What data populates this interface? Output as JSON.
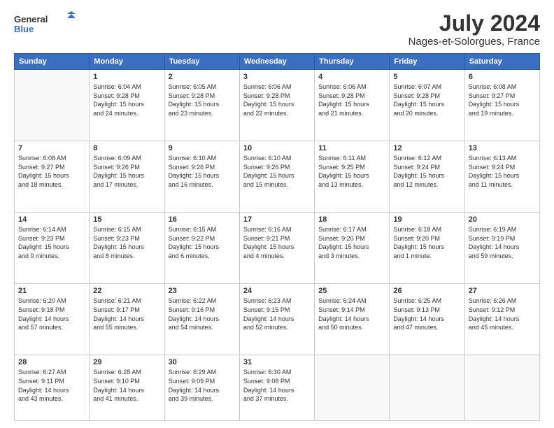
{
  "logo": {
    "line1": "General",
    "line2": "Blue"
  },
  "title": "July 2024",
  "subtitle": "Nages-et-Solorgues, France",
  "days_of_week": [
    "Sunday",
    "Monday",
    "Tuesday",
    "Wednesday",
    "Thursday",
    "Friday",
    "Saturday"
  ],
  "weeks": [
    [
      {
        "day": "",
        "info": ""
      },
      {
        "day": "1",
        "info": "Sunrise: 6:04 AM\nSunset: 9:28 PM\nDaylight: 15 hours\nand 24 minutes."
      },
      {
        "day": "2",
        "info": "Sunrise: 6:05 AM\nSunset: 9:28 PM\nDaylight: 15 hours\nand 23 minutes."
      },
      {
        "day": "3",
        "info": "Sunrise: 6:06 AM\nSunset: 9:28 PM\nDaylight: 15 hours\nand 22 minutes."
      },
      {
        "day": "4",
        "info": "Sunrise: 6:06 AM\nSunset: 9:28 PM\nDaylight: 15 hours\nand 21 minutes."
      },
      {
        "day": "5",
        "info": "Sunrise: 6:07 AM\nSunset: 9:28 PM\nDaylight: 15 hours\nand 20 minutes."
      },
      {
        "day": "6",
        "info": "Sunrise: 6:08 AM\nSunset: 9:27 PM\nDaylight: 15 hours\nand 19 minutes."
      }
    ],
    [
      {
        "day": "7",
        "info": "Sunrise: 6:08 AM\nSunset: 9:27 PM\nDaylight: 15 hours\nand 18 minutes."
      },
      {
        "day": "8",
        "info": "Sunrise: 6:09 AM\nSunset: 9:26 PM\nDaylight: 15 hours\nand 17 minutes."
      },
      {
        "day": "9",
        "info": "Sunrise: 6:10 AM\nSunset: 9:26 PM\nDaylight: 15 hours\nand 16 minutes."
      },
      {
        "day": "10",
        "info": "Sunrise: 6:10 AM\nSunset: 9:26 PM\nDaylight: 15 hours\nand 15 minutes."
      },
      {
        "day": "11",
        "info": "Sunrise: 6:11 AM\nSunset: 9:25 PM\nDaylight: 15 hours\nand 13 minutes."
      },
      {
        "day": "12",
        "info": "Sunrise: 6:12 AM\nSunset: 9:24 PM\nDaylight: 15 hours\nand 12 minutes."
      },
      {
        "day": "13",
        "info": "Sunrise: 6:13 AM\nSunset: 9:24 PM\nDaylight: 15 hours\nand 11 minutes."
      }
    ],
    [
      {
        "day": "14",
        "info": "Sunrise: 6:14 AM\nSunset: 9:23 PM\nDaylight: 15 hours\nand 9 minutes."
      },
      {
        "day": "15",
        "info": "Sunrise: 6:15 AM\nSunset: 9:23 PM\nDaylight: 15 hours\nand 8 minutes."
      },
      {
        "day": "16",
        "info": "Sunrise: 6:15 AM\nSunset: 9:22 PM\nDaylight: 15 hours\nand 6 minutes."
      },
      {
        "day": "17",
        "info": "Sunrise: 6:16 AM\nSunset: 9:21 PM\nDaylight: 15 hours\nand 4 minutes."
      },
      {
        "day": "18",
        "info": "Sunrise: 6:17 AM\nSunset: 9:20 PM\nDaylight: 15 hours\nand 3 minutes."
      },
      {
        "day": "19",
        "info": "Sunrise: 6:18 AM\nSunset: 9:20 PM\nDaylight: 15 hours\nand 1 minute."
      },
      {
        "day": "20",
        "info": "Sunrise: 6:19 AM\nSunset: 9:19 PM\nDaylight: 14 hours\nand 59 minutes."
      }
    ],
    [
      {
        "day": "21",
        "info": "Sunrise: 6:20 AM\nSunset: 9:18 PM\nDaylight: 14 hours\nand 57 minutes."
      },
      {
        "day": "22",
        "info": "Sunrise: 6:21 AM\nSunset: 9:17 PM\nDaylight: 14 hours\nand 55 minutes."
      },
      {
        "day": "23",
        "info": "Sunrise: 6:22 AM\nSunset: 9:16 PM\nDaylight: 14 hours\nand 54 minutes."
      },
      {
        "day": "24",
        "info": "Sunrise: 6:23 AM\nSunset: 9:15 PM\nDaylight: 14 hours\nand 52 minutes."
      },
      {
        "day": "25",
        "info": "Sunrise: 6:24 AM\nSunset: 9:14 PM\nDaylight: 14 hours\nand 50 minutes."
      },
      {
        "day": "26",
        "info": "Sunrise: 6:25 AM\nSunset: 9:13 PM\nDaylight: 14 hours\nand 47 minutes."
      },
      {
        "day": "27",
        "info": "Sunrise: 6:26 AM\nSunset: 9:12 PM\nDaylight: 14 hours\nand 45 minutes."
      }
    ],
    [
      {
        "day": "28",
        "info": "Sunrise: 6:27 AM\nSunset: 9:11 PM\nDaylight: 14 hours\nand 43 minutes."
      },
      {
        "day": "29",
        "info": "Sunrise: 6:28 AM\nSunset: 9:10 PM\nDaylight: 14 hours\nand 41 minutes."
      },
      {
        "day": "30",
        "info": "Sunrise: 6:29 AM\nSunset: 9:09 PM\nDaylight: 14 hours\nand 39 minutes."
      },
      {
        "day": "31",
        "info": "Sunrise: 6:30 AM\nSunset: 9:08 PM\nDaylight: 14 hours\nand 37 minutes."
      },
      {
        "day": "",
        "info": ""
      },
      {
        "day": "",
        "info": ""
      },
      {
        "day": "",
        "info": ""
      }
    ]
  ]
}
